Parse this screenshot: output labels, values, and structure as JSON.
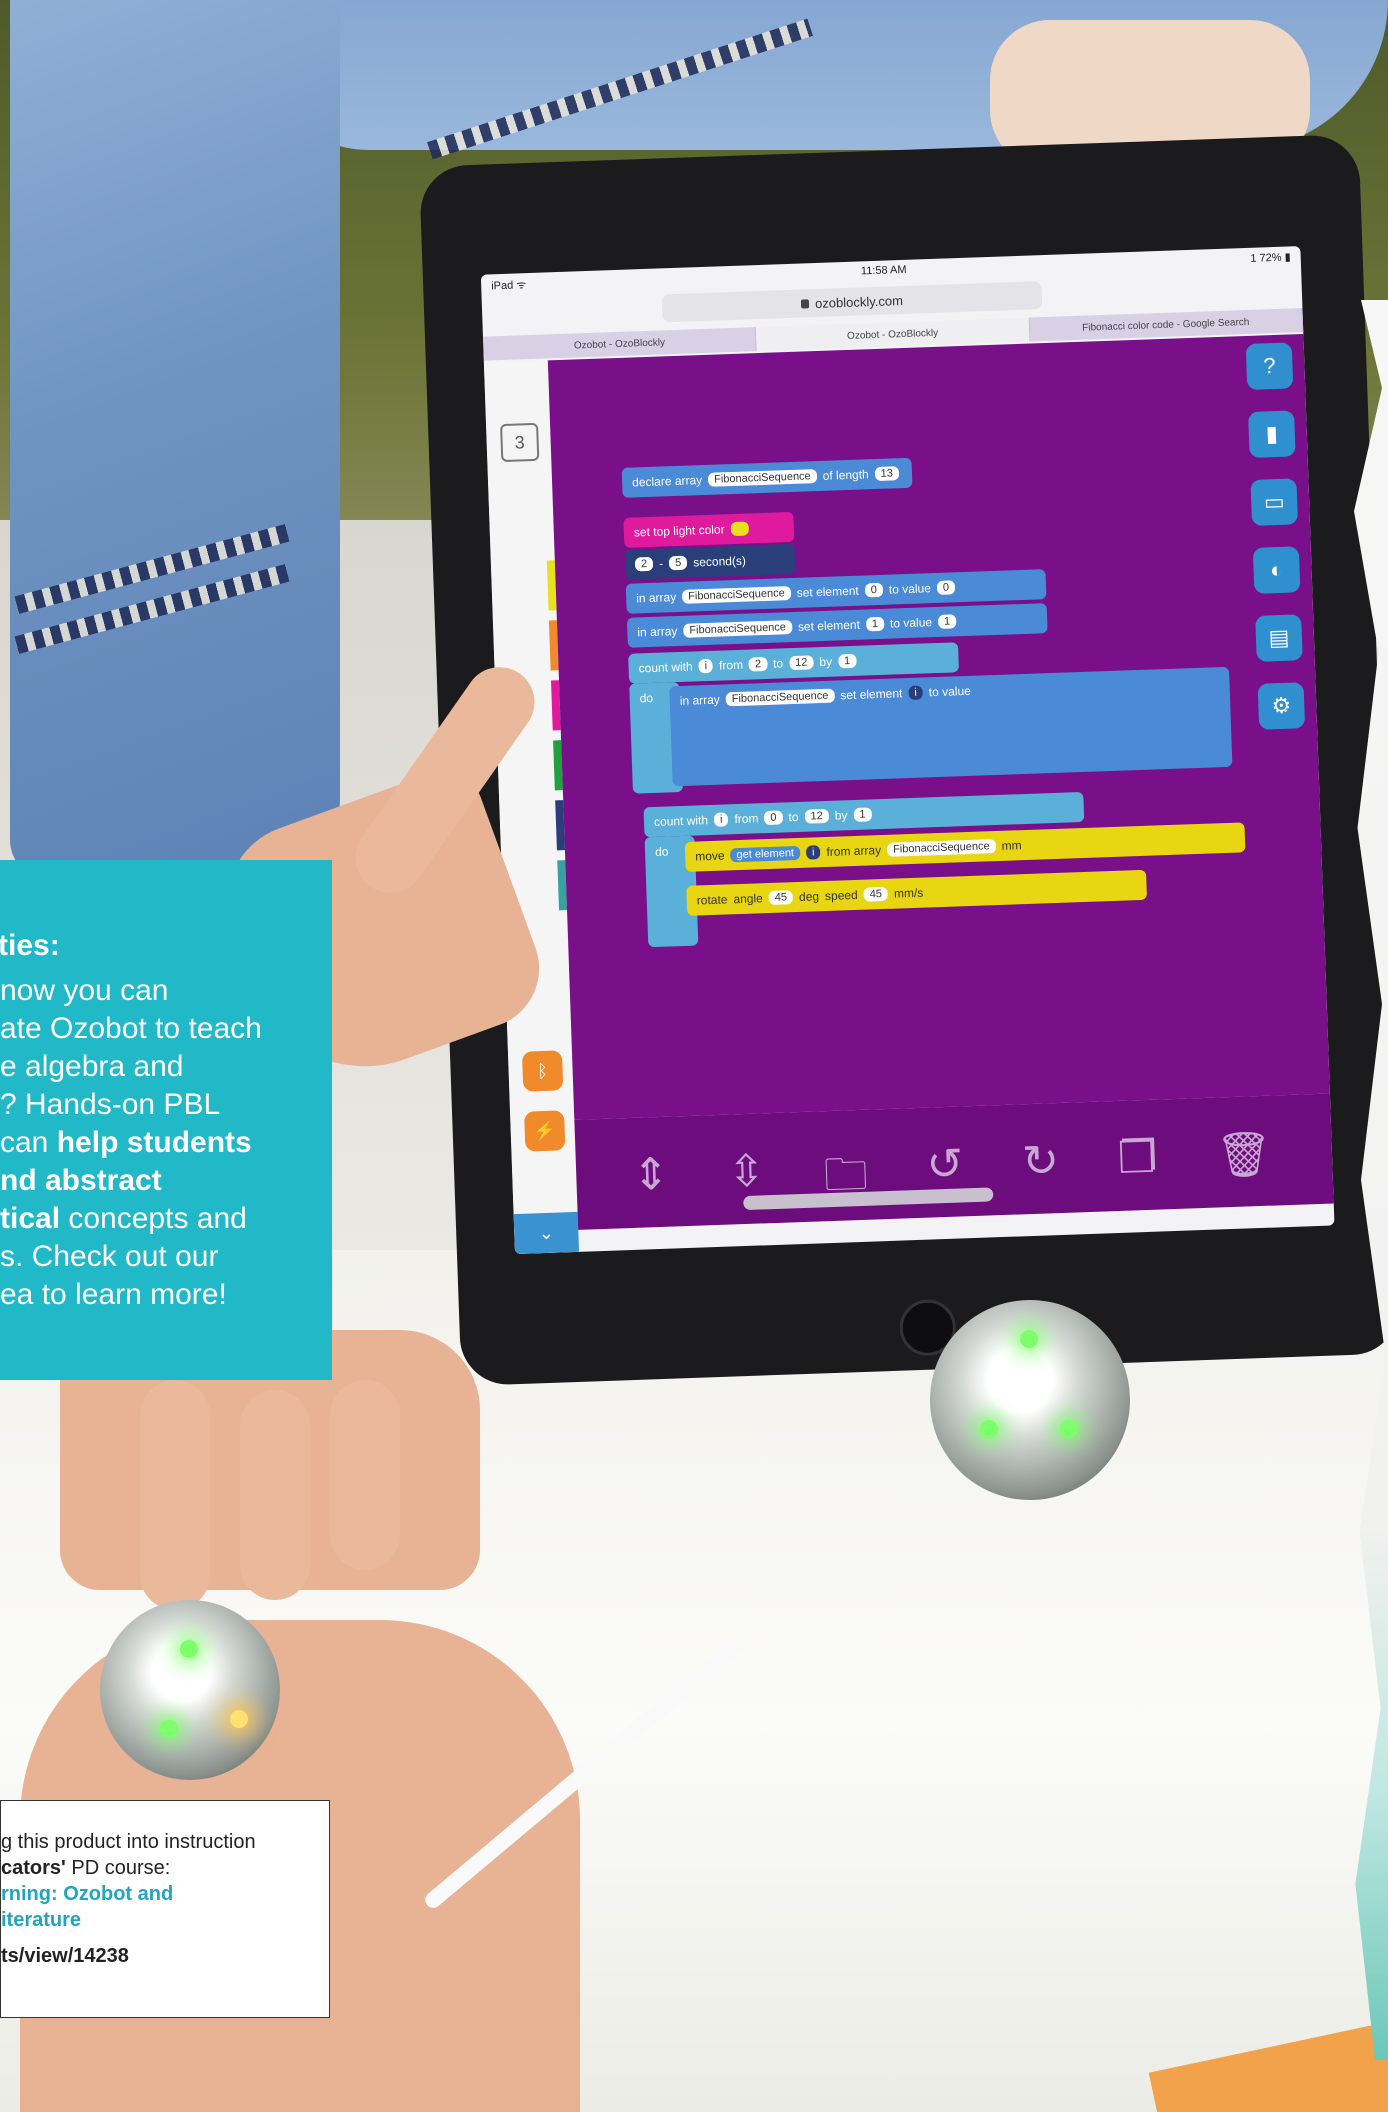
{
  "promo": {
    "title_fragment": "ties:",
    "text_1": "now you can",
    "text_2": "ate Ozobot to teach",
    "text_3": "e algebra and",
    "text_4": "? Hands-on PBL",
    "text_5a": "can ",
    "text_5b": "help students",
    "text_6": "nd abstract",
    "text_7a": "tical",
    "text_7b": " concepts and",
    "text_8": "s. Check out our",
    "text_9": "ea to learn more!"
  },
  "pd_box": {
    "line_1": "g this product into instruction",
    "line_2_strong": "cators'",
    "line_2_rest": " PD course:",
    "link_1": "rning: Ozobot and",
    "link_2": "iterature",
    "url": "ts/view/14238"
  },
  "tablet": {
    "status_left": "iPad ᯤ",
    "status_time": "11:58 AM",
    "status_right": "1 72% ▮",
    "url": "ozoblockly.com",
    "tabs": [
      "Ozobot - OzoBlockly",
      "Ozobot - OzoBlockly",
      "Fibonacci color code - Google Search"
    ],
    "level": "3",
    "blocks": {
      "declare": "declare array",
      "array_name": "FibonacciSequence",
      "of_length": "of length",
      "length_val": "13",
      "set_light": "set top light color",
      "wait_seconds": "second(s)",
      "wait_a": "2",
      "wait_b": "5",
      "in_array": "in array",
      "set_element": "set element",
      "to_value": "to value",
      "v0": "0",
      "v1": "1",
      "count_with": "count with",
      "from": "from",
      "to": "to",
      "by": "by",
      "i": "i",
      "c_from": "2",
      "c_to": "12",
      "c_by": "1",
      "c2_from": "0",
      "c2_to": "12",
      "c2_by": "1",
      "do": "do",
      "move": "move",
      "get_element": "get element",
      "from_array": "from array",
      "mm": "mm",
      "rotate": "rotate",
      "angle": "angle",
      "deg": "deg",
      "speed": "speed",
      "mms": "mm/s",
      "angle_val": "45",
      "speed_val": "45"
    }
  },
  "icons": {
    "help": "question-icon",
    "book": "book-icon",
    "save": "save-icon",
    "bulb": "bulb-icon",
    "file": "file-icon",
    "settings": "settings-icon"
  },
  "colors": {
    "promo_bg": "#21b8c8",
    "workspace": "#7a0f8a",
    "block_blue": "#4a8ad6",
    "block_yellow": "#e8d613",
    "block_pink": "#e01a9c"
  }
}
